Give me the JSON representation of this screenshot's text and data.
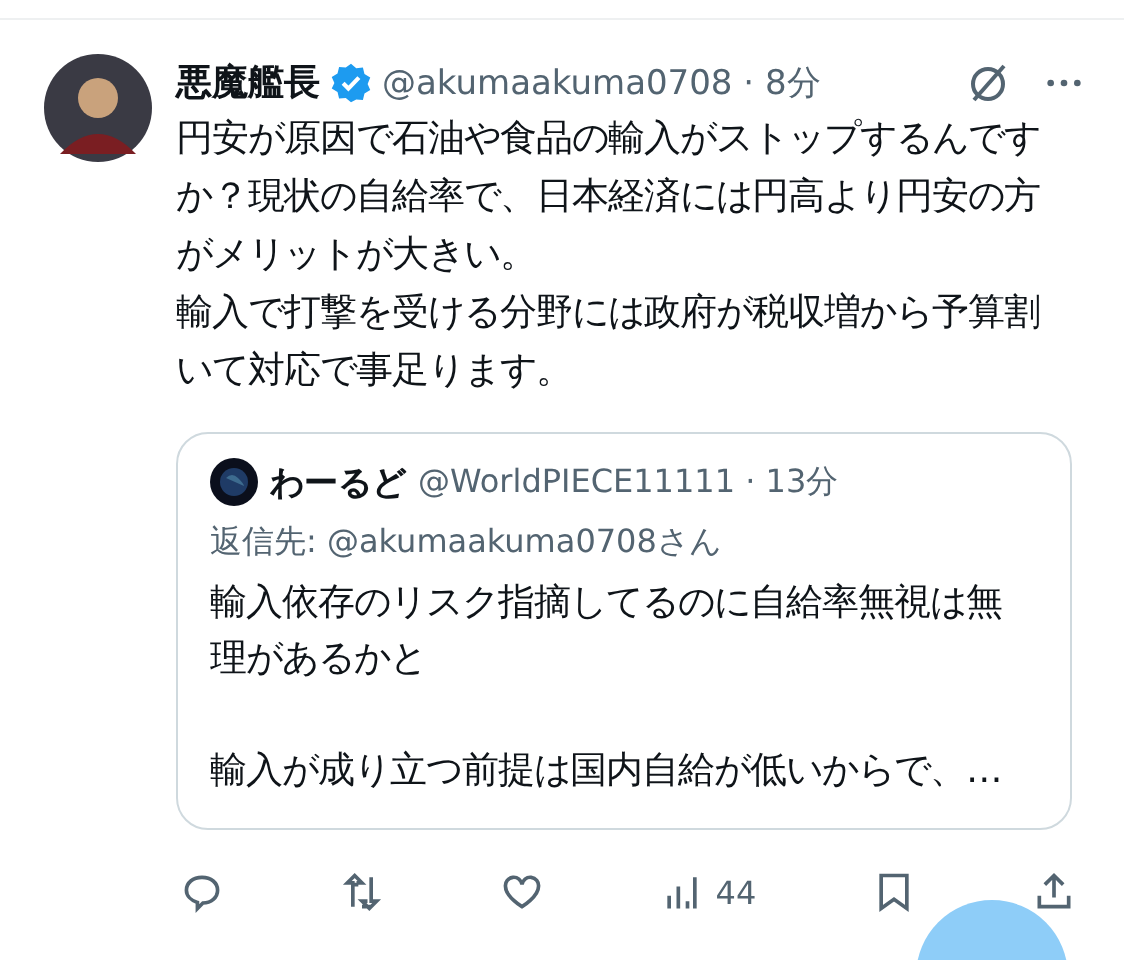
{
  "post": {
    "author": {
      "name": "悪魔艦長",
      "verified": true,
      "meta": "@akumaakuma0708 · 8分"
    },
    "body": [
      "円安が原因で石油や食品の輸入がストップするんですか？現状の自給率で、日本経済には円高より円安の方がメリットが大きい。",
      "輸入で打撃を受ける分野には政府が税収増から予算割いて対応で事足ります。"
    ],
    "quote": {
      "author": {
        "name": "わーるど",
        "meta": "@WorldPIECE11111 · 13分"
      },
      "reply_to": "返信先: @akumaakuma0708さん",
      "body": [
        "輸入依存のリスク指摘してるのに自給率無視は無理があるかと",
        "輸入が成り立つ前提は国内自給が低いからで、…"
      ]
    },
    "actions": [
      {
        "kind": "reply"
      },
      {
        "kind": "repost"
      },
      {
        "kind": "like"
      },
      {
        "kind": "views",
        "count": "44"
      },
      {
        "kind": "bookmark"
      },
      {
        "kind": "share"
      }
    ]
  }
}
